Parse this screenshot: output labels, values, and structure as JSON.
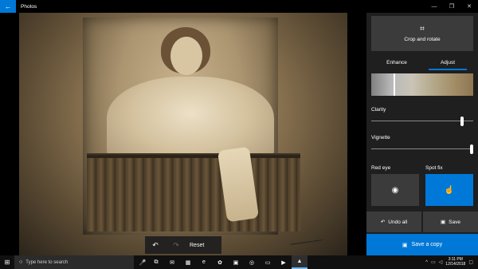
{
  "window": {
    "title": "Photos",
    "back_icon": "back-arrow-icon",
    "minimize": "—",
    "maximize": "❐",
    "close": "✕"
  },
  "photo_toolbar": {
    "undo_icon": "↶",
    "redo_icon": "↷",
    "reset_label": "Reset"
  },
  "panel": {
    "crop_icon": "⌗",
    "crop_label": "Crop and rotate",
    "tabs": [
      {
        "label": "Enhance",
        "active": false
      },
      {
        "label": "Adjust",
        "active": true
      }
    ],
    "sliders": [
      {
        "label": "Clarity",
        "value": 0.9
      },
      {
        "label": "Vignette",
        "value": 1.0
      }
    ],
    "red_eye_label": "Red eye",
    "spot_fix_label": "Spot fix",
    "red_eye_icon": "◉",
    "spot_fix_icon": "☝",
    "undo_all_icon": "↶",
    "undo_all_label": "Undo all",
    "save_icon": "▣",
    "save_label": "Save",
    "save_copy_icon": "▣",
    "save_copy_label": "Save a copy"
  },
  "taskbar": {
    "start_icon": "⊞",
    "search_placeholder": "Type here to search",
    "search_icon": "○",
    "mic_icon": "🎤",
    "apps": [
      {
        "name": "task-view-icon",
        "glyph": "⧉"
      },
      {
        "name": "mail-icon",
        "glyph": "✉"
      },
      {
        "name": "store-icon",
        "glyph": "▦"
      },
      {
        "name": "edge-icon",
        "glyph": "e"
      },
      {
        "name": "paint-icon",
        "glyph": "✿"
      },
      {
        "name": "photos-app-icon",
        "glyph": "▣"
      },
      {
        "name": "chrome-icon",
        "glyph": "◎"
      },
      {
        "name": "file-explorer-icon",
        "glyph": "▭"
      },
      {
        "name": "media-icon",
        "glyph": "▶"
      },
      {
        "name": "photos-running-icon",
        "glyph": "▲"
      }
    ],
    "time": "3:11 PM",
    "date": "12/14/2018"
  }
}
